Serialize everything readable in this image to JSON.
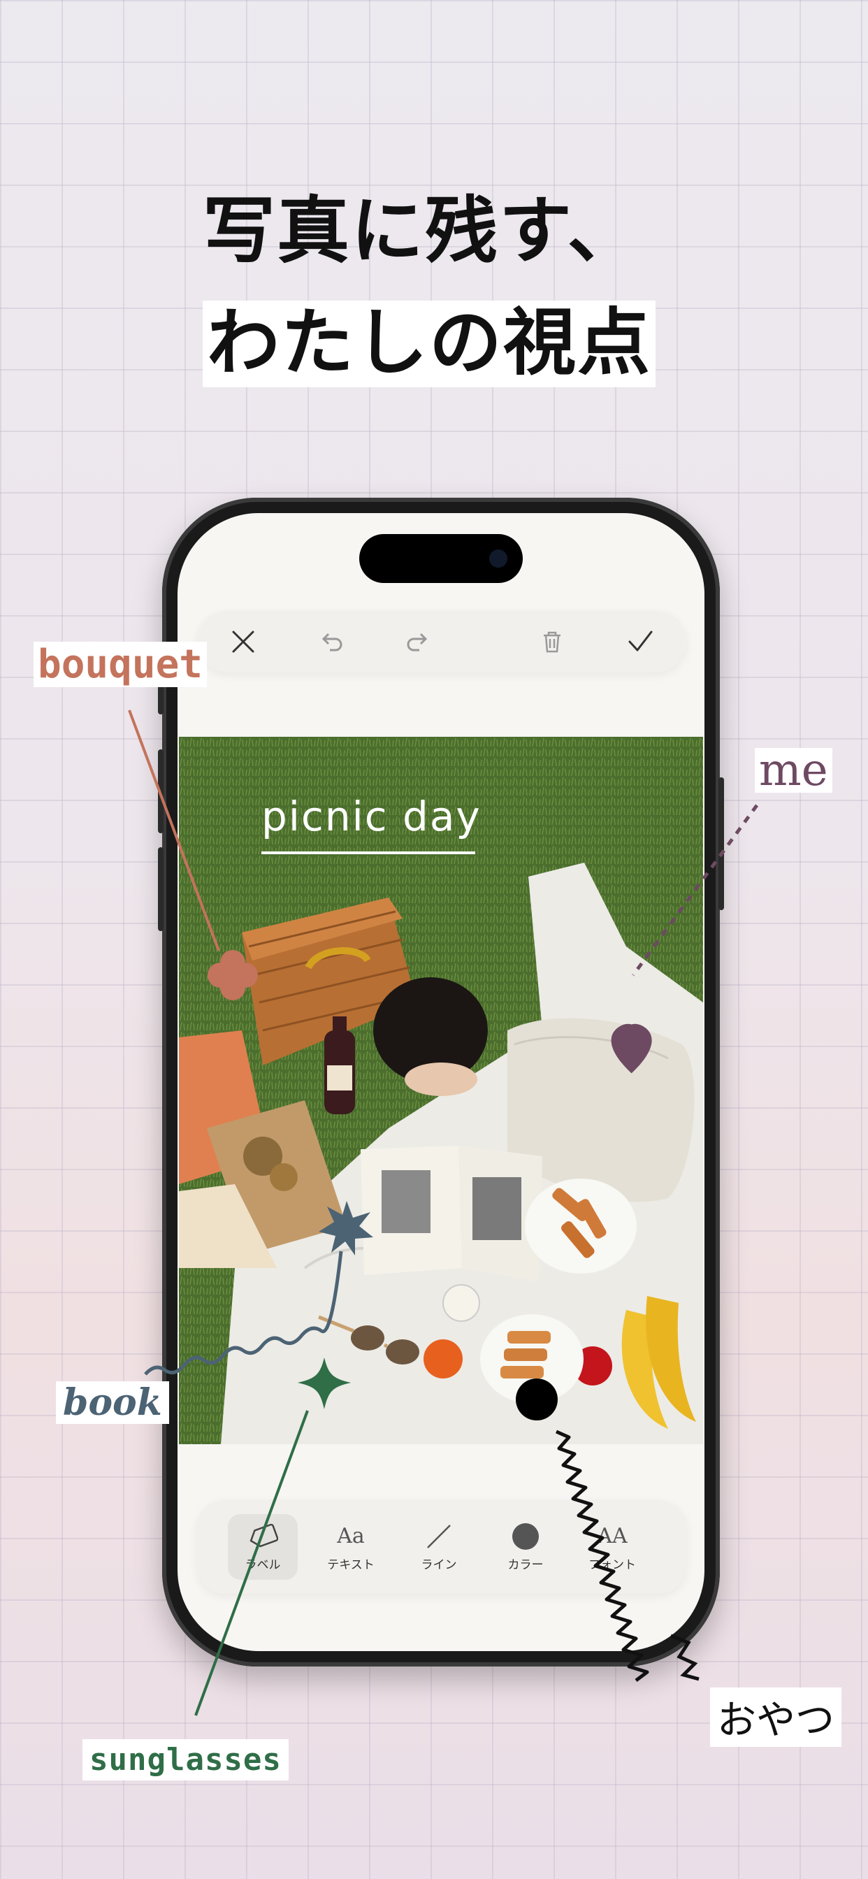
{
  "headline": {
    "line1": "写真に残す、",
    "line2": "わたしの視点"
  },
  "editor": {
    "toolbar": {
      "close": "close-icon",
      "undo": "undo-icon",
      "redo": "redo-icon",
      "delete": "trash-icon",
      "confirm": "check-icon"
    },
    "photo_title": "picnic day",
    "tools": [
      {
        "label": "ラベル",
        "icon": "tag-icon"
      },
      {
        "label": "テキスト",
        "icon": "text-icon",
        "glyph": "Aa"
      },
      {
        "label": "ライン",
        "icon": "line-icon"
      },
      {
        "label": "カラー",
        "icon": "color-dot-icon"
      },
      {
        "label": "フォント",
        "icon": "font-icon",
        "glyph": "AA"
      }
    ]
  },
  "annotations": {
    "bouquet": "bouquet",
    "me": "me",
    "book": "book",
    "sunglasses": "sunglasses",
    "oyatsu": "おやつ"
  },
  "colors": {
    "bouquet": "#c4735c",
    "me": "#6d4a62",
    "book": "#4c6374",
    "sunglasses": "#2f6e47",
    "oyatsu": "#111111"
  }
}
